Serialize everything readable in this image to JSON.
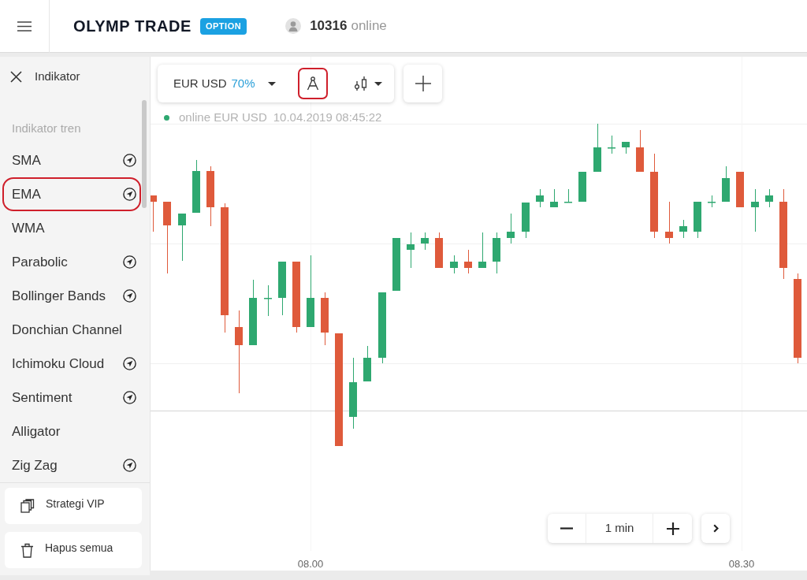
{
  "header": {
    "logo": "OLYMP TRADE",
    "badge": "OPTION",
    "online_count": "10316",
    "online_label": "online"
  },
  "sidebar": {
    "title": "Indikator",
    "section": "Indikator tren",
    "items": [
      {
        "label": "SMA",
        "settings_icon": true,
        "annotated": false
      },
      {
        "label": "EMA",
        "settings_icon": true,
        "annotated": true
      },
      {
        "label": "WMA",
        "settings_icon": false,
        "annotated": false
      },
      {
        "label": "Parabolic",
        "settings_icon": true,
        "annotated": false
      },
      {
        "label": "Bollinger Bands",
        "settings_icon": true,
        "annotated": false
      },
      {
        "label": "Donchian Channel",
        "settings_icon": false,
        "annotated": false
      },
      {
        "label": "Ichimoku Cloud",
        "settings_icon": true,
        "annotated": false
      },
      {
        "label": "Sentiment",
        "settings_icon": true,
        "annotated": false
      },
      {
        "label": "Alligator",
        "settings_icon": false,
        "annotated": false
      },
      {
        "label": "Zig Zag",
        "settings_icon": true,
        "annotated": false
      }
    ],
    "actions": [
      {
        "kind": "strategies",
        "label": "Strategi VIP"
      },
      {
        "kind": "delete",
        "label": "Hapus semua"
      }
    ]
  },
  "toolbar": {
    "pair": "EUR USD",
    "payout": "70%",
    "tools": [
      {
        "kind": "drawing",
        "annotated": true
      },
      {
        "kind": "chart-type",
        "annotated": false
      }
    ]
  },
  "status": {
    "label": "online EUR USD",
    "timestamp": "10.04.2019 08:45:22"
  },
  "time_axis": [
    "08.00",
    "08.30"
  ],
  "timeframe": {
    "value": "1 min"
  }
}
